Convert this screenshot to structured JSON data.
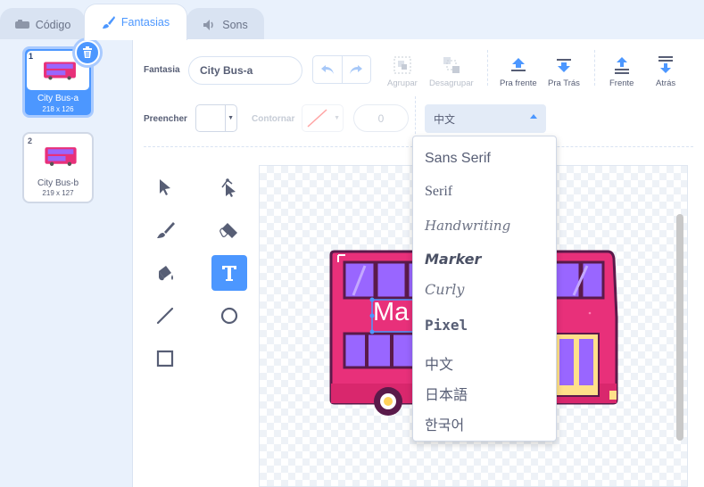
{
  "tabs": [
    {
      "label": "Código",
      "icon": "code-icon"
    },
    {
      "label": "Fantasias",
      "icon": "brush-icon",
      "active": true
    },
    {
      "label": "Sons",
      "icon": "speaker-icon"
    }
  ],
  "costumes": [
    {
      "number": "1",
      "name": "City Bus-a",
      "size": "218 x 126",
      "selected": true
    },
    {
      "number": "2",
      "name": "City Bus-b",
      "size": "219 x 127",
      "selected": false
    }
  ],
  "toolbar": {
    "costume_label": "Fantasia",
    "costume_name": "City Bus-a",
    "group_label": "Agrupar",
    "ungroup_label": "Desagrupar",
    "forward_label": "Pra frente",
    "backward_label": "Pra Trás",
    "front_label": "Frente",
    "back_label": "Atrás",
    "fill_label": "Preencher",
    "outline_label": "Contornar",
    "outline_width": "0",
    "font_selected": "中文"
  },
  "font_options": [
    "Sans Serif",
    "Serif",
    "Handwriting",
    "Marker",
    "Curly",
    "Pixel",
    "中文",
    "日本語",
    "한국어"
  ],
  "canvas_text": "Ma",
  "colors": {
    "accent": "#4c97ff",
    "bus_body": "#e8307a",
    "bus_window": "#9966ff",
    "door": "#ffe08a"
  }
}
